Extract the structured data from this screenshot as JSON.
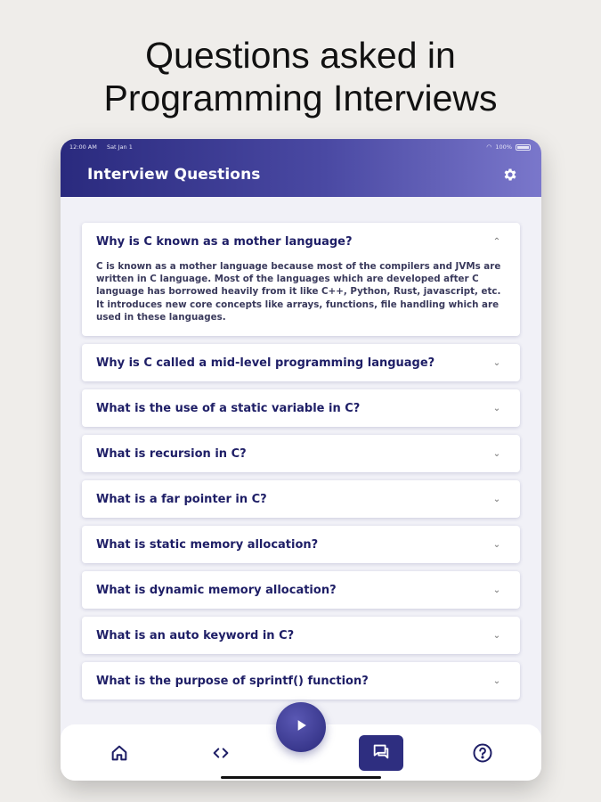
{
  "headline": [
    "Questions asked in",
    "Programming Interviews"
  ],
  "status_bar": {
    "time": "12:00 AM",
    "date": "Sat Jan 1",
    "battery": "100%"
  },
  "app_bar": {
    "title": "Interview Questions",
    "settings_icon": "gear-icon"
  },
  "questions": [
    {
      "question": "Why is C known as a mother language?",
      "expanded": true,
      "answer": "C is known as a mother language because most of the compilers and JVMs are written in C language. Most of the languages which are developed after C language has borrowed heavily from it like C++, Python, Rust, javascript, etc. It introduces new core concepts like arrays, functions, file handling which are used in these languages."
    },
    {
      "question": "Why is C called a mid-level programming language?",
      "expanded": false
    },
    {
      "question": "What is the use of a static variable in C?",
      "expanded": false
    },
    {
      "question": "What is recursion in C?",
      "expanded": false
    },
    {
      "question": "What is a far pointer in C?",
      "expanded": false
    },
    {
      "question": "What is static memory allocation?",
      "expanded": false
    },
    {
      "question": "What is dynamic memory allocation?",
      "expanded": false
    },
    {
      "question": "What is an auto keyword in C?",
      "expanded": false
    },
    {
      "question": "What is the purpose of sprintf() function?",
      "expanded": false
    }
  ],
  "bottom_nav": {
    "items": [
      "home-icon",
      "code-icon",
      "chat-icon",
      "help-icon"
    ],
    "active": "chat-icon",
    "fab_icon": "play-icon"
  },
  "colors": {
    "primary": "#2e2e80",
    "question_text": "#1e1e66",
    "accent_gradient_end": "#7a77cb"
  }
}
